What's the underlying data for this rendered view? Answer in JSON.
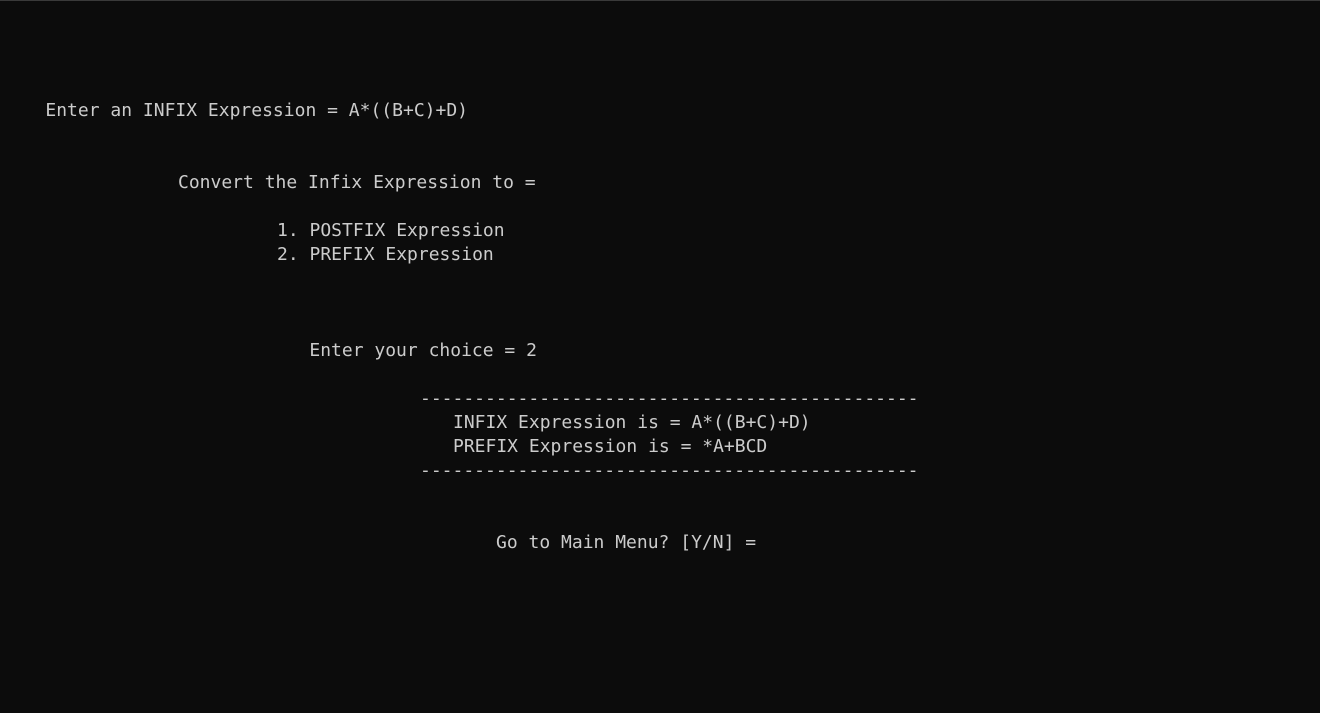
{
  "console": {
    "infix_prompt": "Enter an INFIX Expression = ",
    "infix_input": "A*((B+C)+D)",
    "convert_heading": "Convert the Infix Expression to =",
    "menu_options": [
      "1. POSTFIX Expression",
      "2. PREFIX Expression"
    ],
    "choice_prompt": "Enter your choice = ",
    "choice_input": "2",
    "rule_line": "----------------------------------------------",
    "result_infix": "INFIX Expression is = A*((B+C)+D)",
    "result_prefix": "PREFIX Expression is = *A+BCD",
    "main_menu_prompt": "Go to Main Menu? [Y/N] = "
  },
  "colors": {
    "background": "#0c0c0c",
    "text": "#cccccc"
  }
}
